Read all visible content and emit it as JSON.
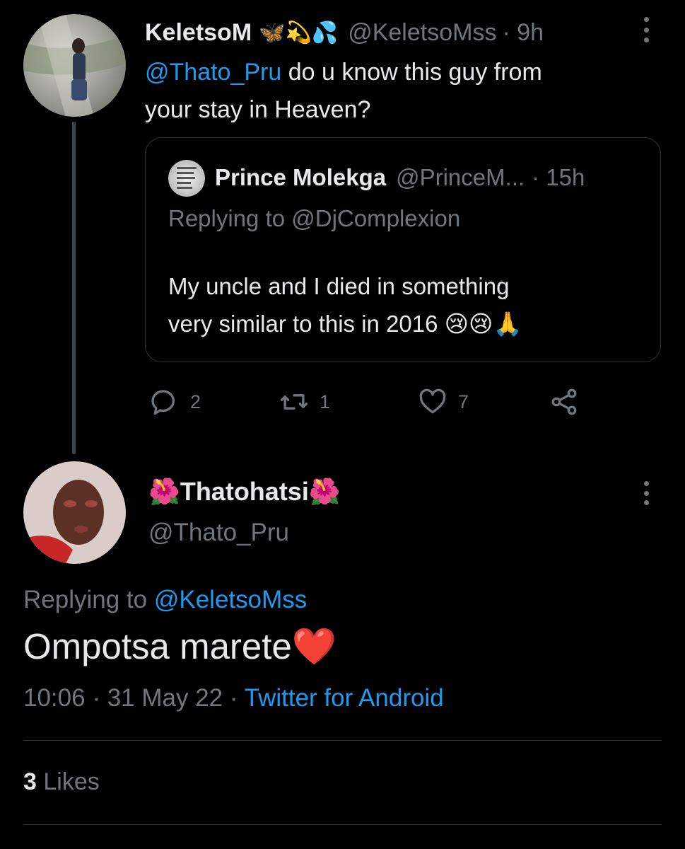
{
  "parent_tweet": {
    "display_name": "KeletsoM",
    "name_emojis": "🦋💫💦",
    "handle": "@KeletsoMss",
    "time": "· 9h",
    "mention": "@Thato_Pru",
    "text_line_1": " do u know this guy from",
    "text_line_2": "your stay in Heaven?",
    "quoted": {
      "display_name": "Prince Molekga",
      "handle": "@PrinceM...",
      "time": "· 15h",
      "replying_prefix": "Replying to ",
      "replying_to": "@DjComplexion",
      "text_line_1": "My uncle and I died in something",
      "text_line_2": "very similar to this in 2016 ",
      "text_emojis": "😢😢🙏"
    },
    "actions": {
      "reply_count": "2",
      "retweet_count": "1",
      "like_count": "7"
    }
  },
  "main_tweet": {
    "display_name_prefix_emoji": "🌺",
    "display_name": "Thatohatsi",
    "display_name_suffix_emoji": "🌺",
    "handle": "@Thato_Pru",
    "replying_prefix": "Replying to ",
    "replying_to": "@KeletsoMss",
    "text": "Ompotsa marete",
    "text_emoji": "❤️",
    "time": "10:06",
    "date": "31 May 22",
    "separator": " · ",
    "source": "Twitter for Android",
    "likes_count": "3",
    "likes_label": " Likes"
  },
  "colors": {
    "background": "#000000",
    "text": "#e7e9ea",
    "muted": "#71767b",
    "link": "#1d9bf0",
    "border": "#2f3336"
  },
  "icons": [
    "more-vertical-icon",
    "reply-icon",
    "retweet-icon",
    "like-icon",
    "share-icon"
  ]
}
